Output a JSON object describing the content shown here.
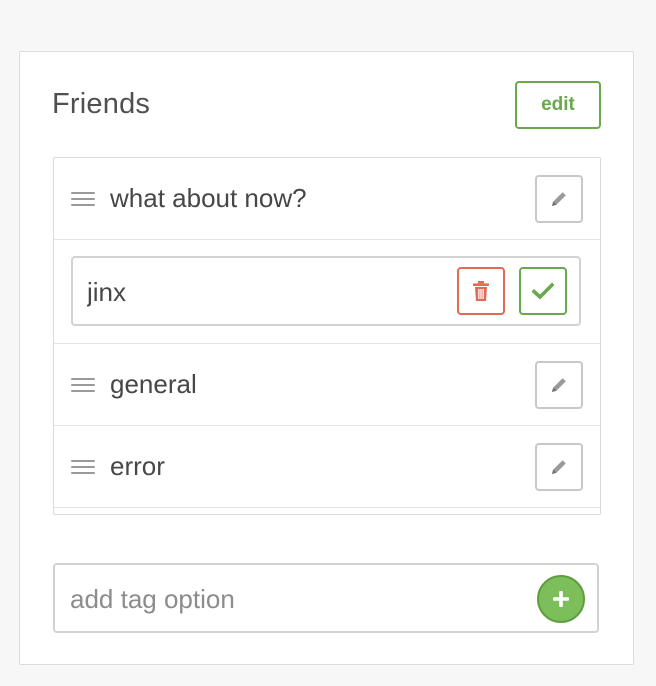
{
  "panel": {
    "title": "Friends",
    "edit_label": "edit"
  },
  "tags": {
    "items": [
      {
        "label": "what about now?",
        "icon": "pencil-icon",
        "editing": false
      },
      {
        "value": "jinx",
        "editing": true,
        "delete_icon": "trash-icon",
        "confirm_icon": "check-icon"
      },
      {
        "label": "general",
        "icon": "pencil-icon",
        "editing": false
      },
      {
        "label": "error",
        "icon": "pencil-icon",
        "editing": false
      }
    ]
  },
  "add_tag": {
    "placeholder": "add tag option",
    "value": "",
    "icon": "plus-icon"
  },
  "colors": {
    "accent_green": "#6aa84f",
    "add_button_green": "#7cbf5a",
    "delete_red": "#e06a56",
    "border_gray": "#d2d2d2",
    "text": "#474747"
  }
}
